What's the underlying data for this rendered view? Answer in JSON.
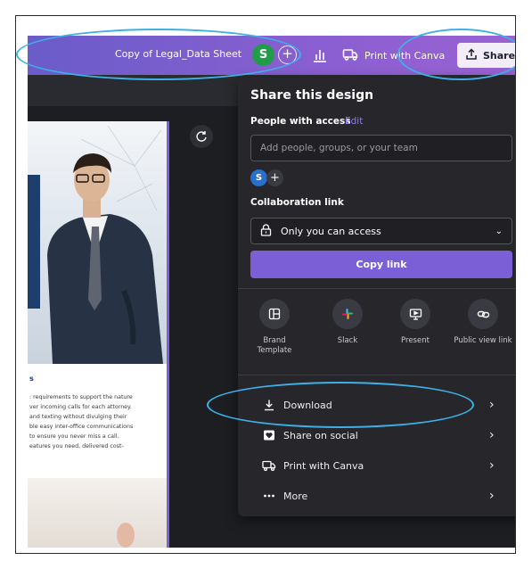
{
  "header": {
    "doc_title": "Copy of Legal_Data Sheet",
    "avatar_initial": "S",
    "add_people": "+",
    "print_label": "Print with Canva",
    "share_label": "Share"
  },
  "document": {
    "heading": "s",
    "text_lines": [
      ": requirements to support the nature",
      "ver incoming calls for each attorney.",
      "and texting without divulging their",
      "ble easy inter-office communications",
      "to ensure you never miss a call.",
      "eatures you need, delivered cost-"
    ]
  },
  "share_panel": {
    "title": "Share this design",
    "people_label": "People with access",
    "edit_label": "Edit",
    "add_placeholder": "Add people, groups, or your team",
    "member_initial": "S",
    "member_plus": "+",
    "collab_label": "Collaboration link",
    "access_value": "Only you can access",
    "copy_link": "Copy link",
    "options": [
      {
        "label": "Brand Template",
        "icon": "brand-template-icon"
      },
      {
        "label": "Slack",
        "icon": "slack-icon"
      },
      {
        "label": "Present",
        "icon": "present-icon"
      },
      {
        "label": "Public view link",
        "icon": "link-icon"
      }
    ],
    "menu": [
      {
        "label": "Download",
        "icon": "download-icon"
      },
      {
        "label": "Share on social",
        "icon": "heart-icon"
      },
      {
        "label": "Print with Canva",
        "icon": "truck-icon"
      },
      {
        "label": "More",
        "icon": "more-icon"
      }
    ]
  },
  "colors": {
    "accent": "#7b5fd6",
    "header_gradient_start": "#6a5cc9",
    "panel_bg": "#26262b",
    "annotation": "#3db0e6"
  }
}
